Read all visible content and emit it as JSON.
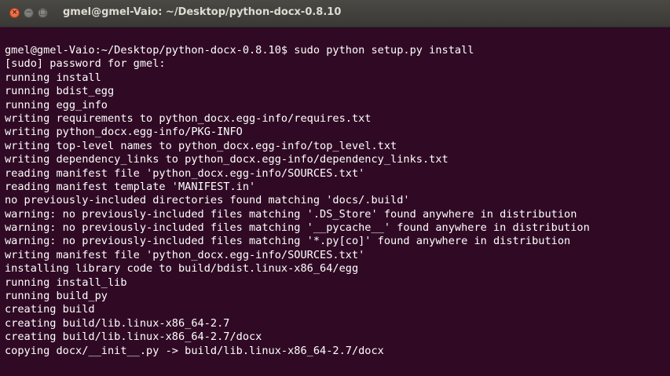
{
  "window": {
    "title": "gmel@gmel-Vaio: ~/Desktop/python-docx-0.8.10",
    "close_icon": "×",
    "minimize_icon": "−",
    "maximize_icon": "□"
  },
  "terminal": {
    "lines": [
      "gmel@gmel-Vaio:~/Desktop/python-docx-0.8.10$ sudo python setup.py install",
      "[sudo] password for gmel:",
      "running install",
      "running bdist_egg",
      "running egg_info",
      "writing requirements to python_docx.egg-info/requires.txt",
      "writing python_docx.egg-info/PKG-INFO",
      "writing top-level names to python_docx.egg-info/top_level.txt",
      "writing dependency_links to python_docx.egg-info/dependency_links.txt",
      "reading manifest file 'python_docx.egg-info/SOURCES.txt'",
      "reading manifest template 'MANIFEST.in'",
      "no previously-included directories found matching 'docs/.build'",
      "warning: no previously-included files matching '.DS_Store' found anywhere in distribution",
      "warning: no previously-included files matching '__pycache__' found anywhere in distribution",
      "warning: no previously-included files matching '*.py[co]' found anywhere in distribution",
      "writing manifest file 'python_docx.egg-info/SOURCES.txt'",
      "installing library code to build/bdist.linux-x86_64/egg",
      "running install_lib",
      "running build_py",
      "creating build",
      "creating build/lib.linux-x86_64-2.7",
      "creating build/lib.linux-x86_64-2.7/docx",
      "copying docx/__init__.py -> build/lib.linux-x86_64-2.7/docx"
    ]
  },
  "colors": {
    "background": "#300a24",
    "text": "#ffffff",
    "titlebar": "#3c3b37",
    "title_text": "#dfdbd2",
    "close_button": "#e95420"
  }
}
